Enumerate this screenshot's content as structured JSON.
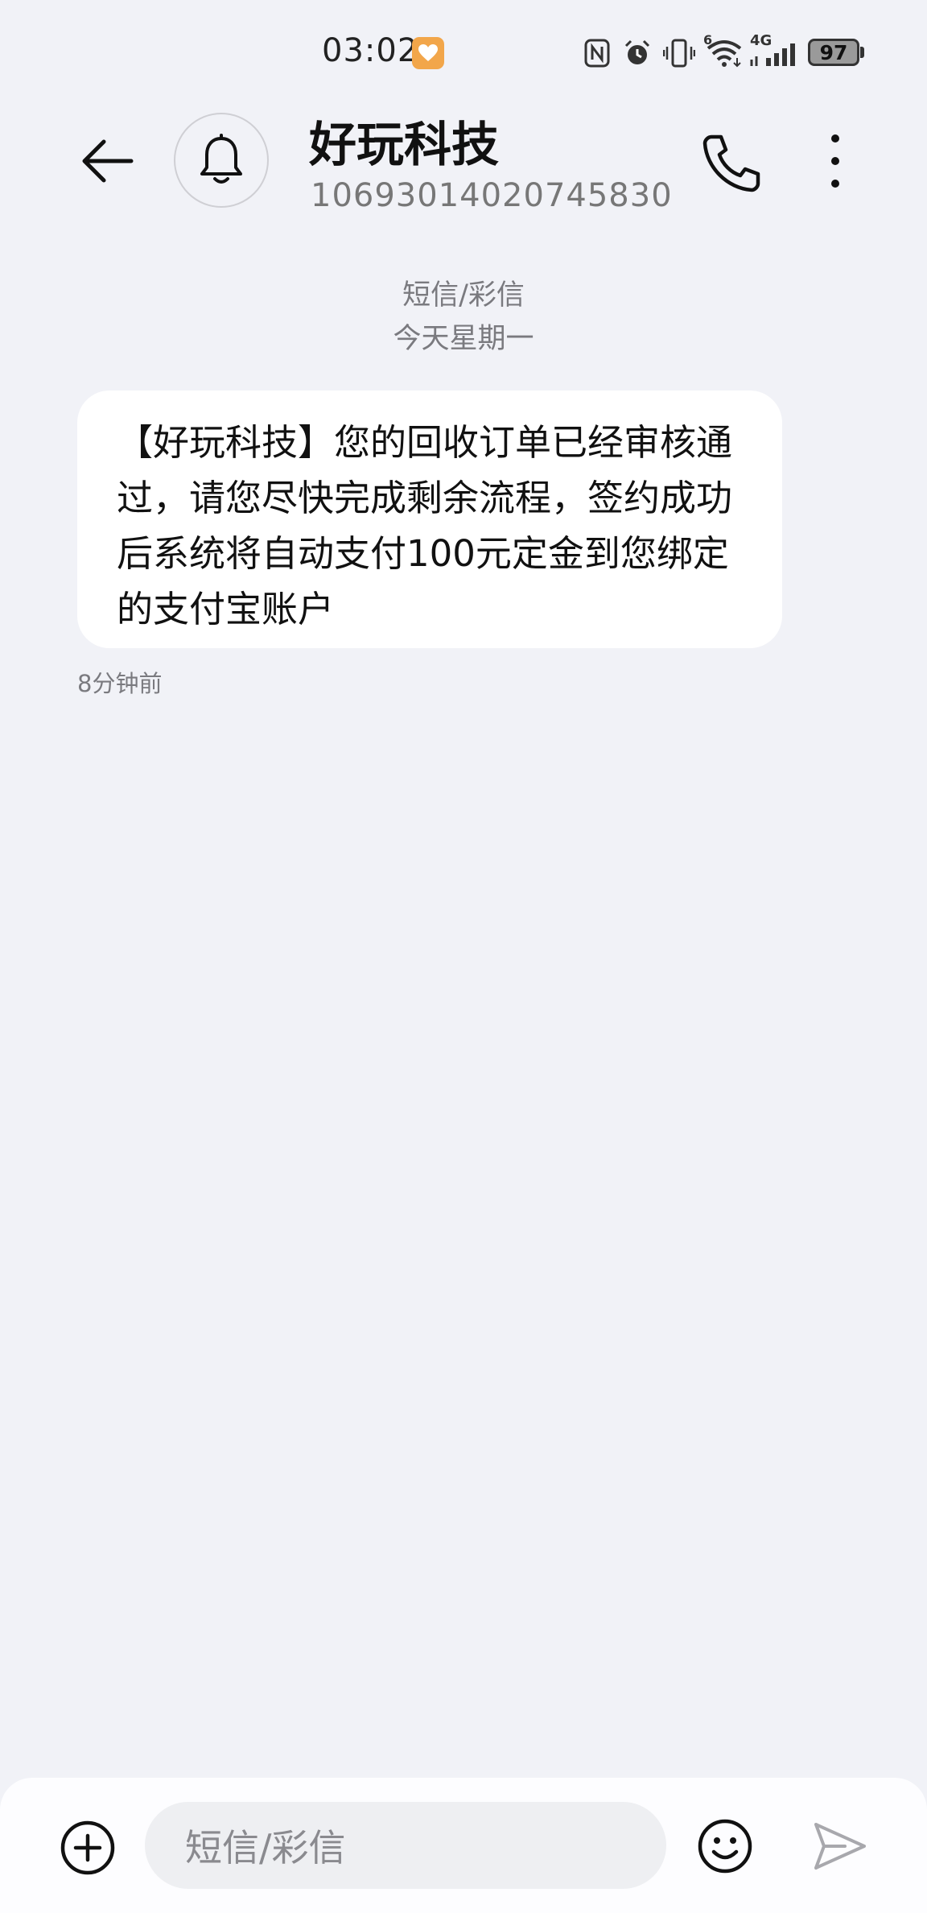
{
  "status_bar": {
    "time": "03:02",
    "network": "4G",
    "wifi_badge": "6",
    "battery": "97",
    "icons": [
      "heart-app-icon",
      "nfc-icon",
      "alarm-icon",
      "vibrate-icon",
      "wifi-icon",
      "signal-icon",
      "battery-icon"
    ]
  },
  "header": {
    "contact_name": "好玩科技",
    "contact_number": "10693014020745830",
    "icons": [
      "back-arrow-icon",
      "bell-icon",
      "phone-icon",
      "more-vertical-icon"
    ]
  },
  "conversation": {
    "message_type": "短信/彩信",
    "date": "今天星期一",
    "messages": [
      {
        "text": "【好玩科技】您的回收订单已经审核通过，请您尽快完成剩余流程，签约成功后系统将自动支付100元定金到您绑定的支付宝账户",
        "time": "8分钟前"
      }
    ]
  },
  "composer": {
    "placeholder": "短信/彩信",
    "icons": [
      "add-circle-icon",
      "emoji-icon",
      "send-icon"
    ]
  },
  "colors": {
    "background": "#f1f2f7",
    "bubble": "#ffffff",
    "secondary_text": "#7a7a7f",
    "status_heart": "#f2a64a"
  }
}
